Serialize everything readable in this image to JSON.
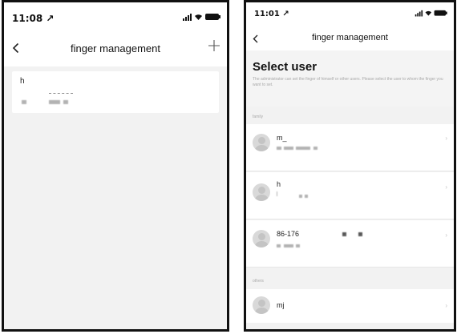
{
  "phone_a": {
    "status": {
      "time": "11:08 ↗"
    },
    "nav": {
      "title": "finger management"
    },
    "card": {
      "name": "h"
    }
  },
  "phone_b": {
    "status": {
      "time": "11:01 ↗"
    },
    "nav": {
      "title": "finger management"
    },
    "header": {
      "title": "Select user",
      "description": "The administrator can set the finger of himself or other users. Please select the user to whom the finger you want to set."
    },
    "groups": [
      {
        "label": "family"
      },
      {
        "label": "others"
      }
    ],
    "users": [
      {
        "name": "m_"
      },
      {
        "name": "h"
      },
      {
        "name": "86-176"
      },
      {
        "name": "mj"
      }
    ],
    "chevron": "›"
  }
}
